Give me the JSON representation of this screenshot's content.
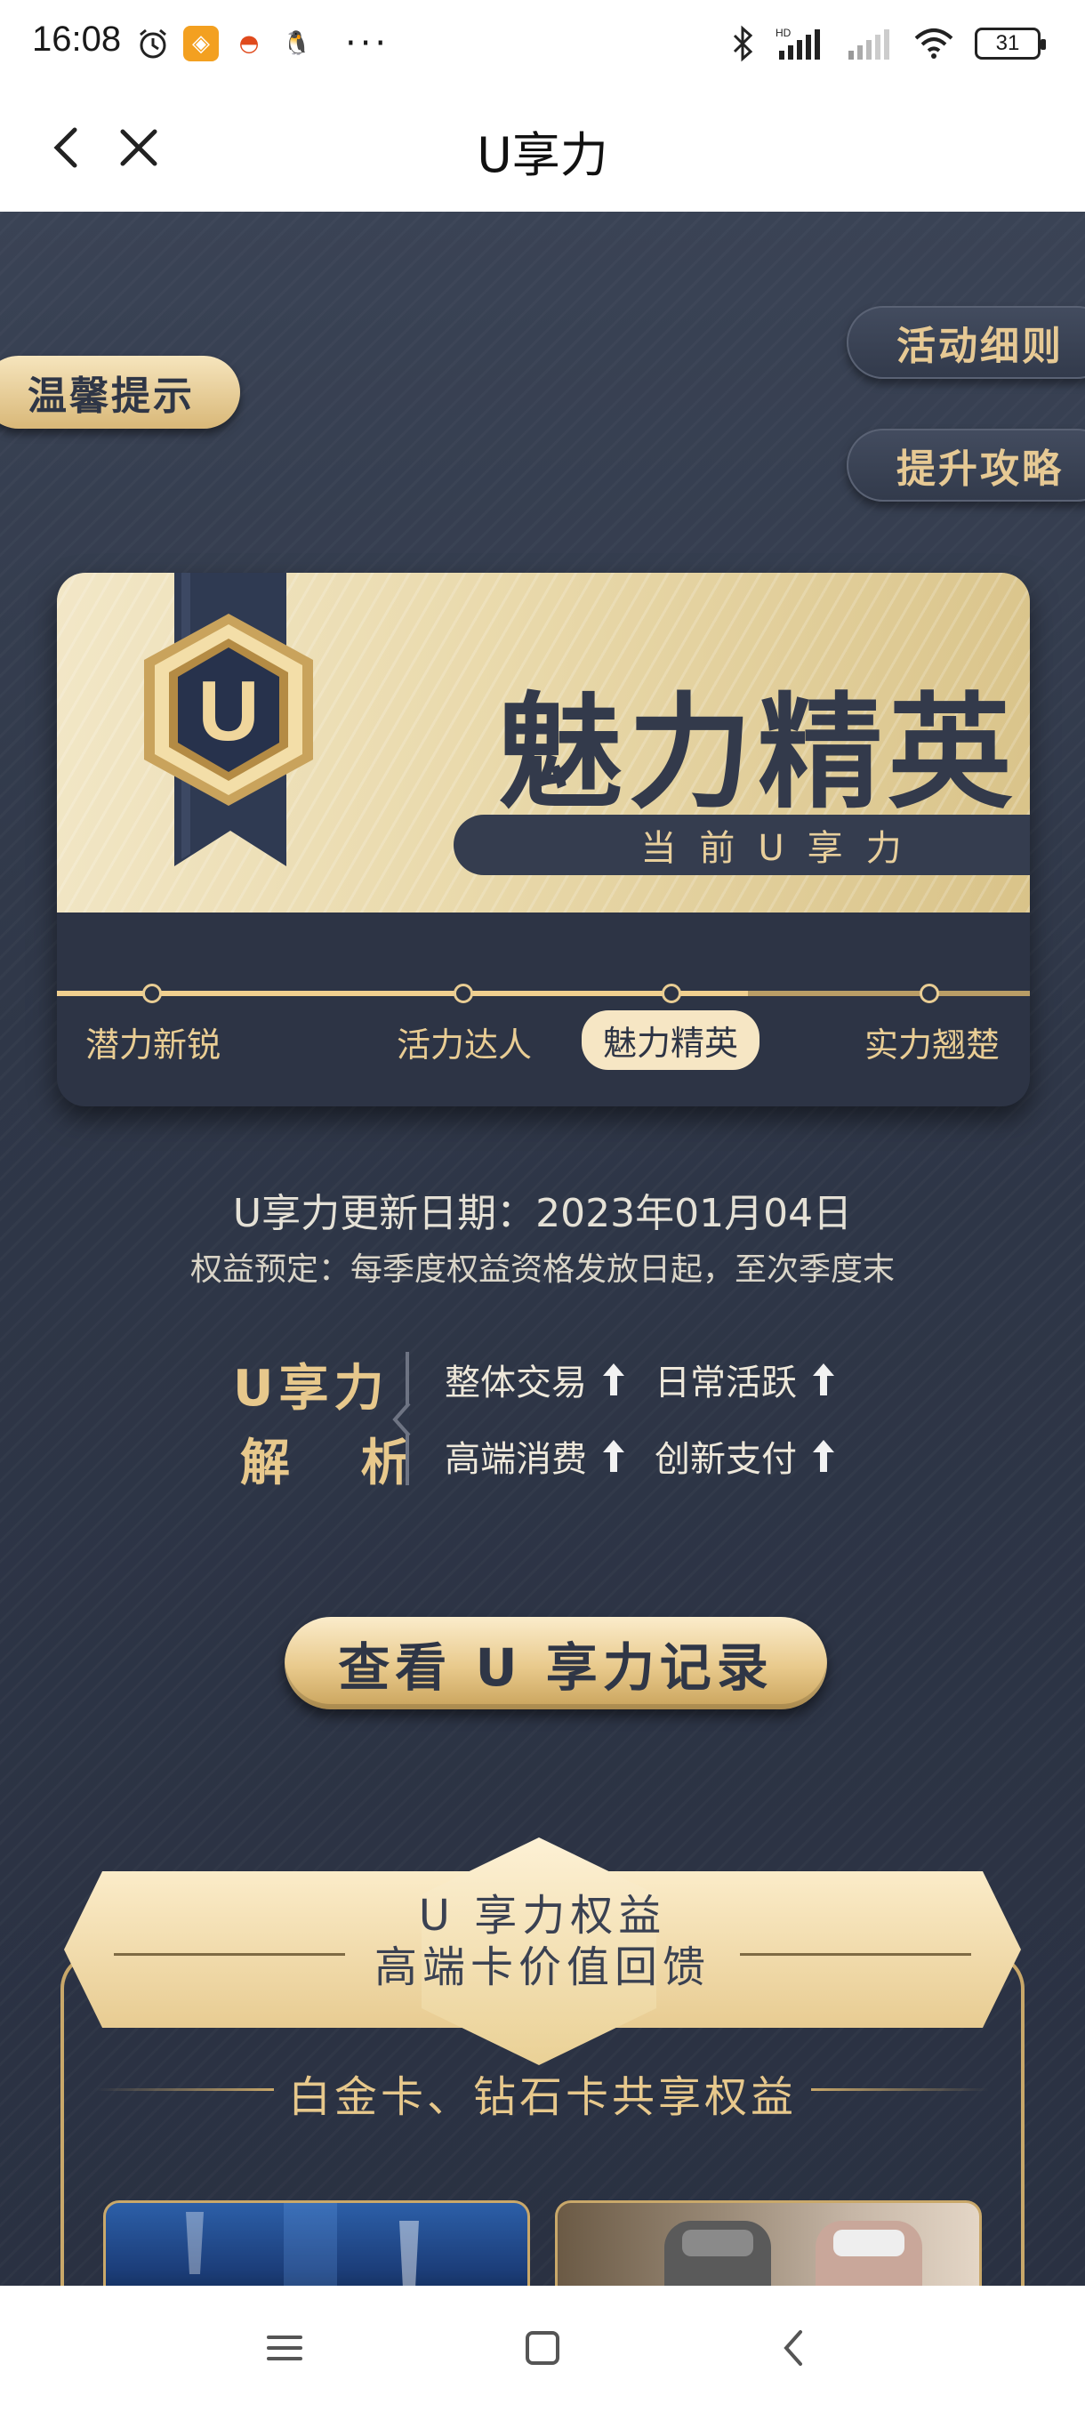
{
  "status_bar": {
    "time": "16:08",
    "battery": "31",
    "icons": [
      "alarm-icon",
      "app-orange-icon",
      "app-red-icon",
      "qq-icon",
      "more-dots-icon",
      "bluetooth-icon",
      "hd-signal-icon",
      "signal-icon",
      "wifi-icon",
      "battery-icon"
    ]
  },
  "nav": {
    "title": "U享力"
  },
  "buttons": {
    "tips": "温馨提示",
    "rules": "活动细则",
    "strategy": "提升攻略"
  },
  "level_card": {
    "badge_letter": "U",
    "level_name": "魅力精英",
    "current_label": "当前U享力",
    "progress_fraction": 0.71,
    "levels": [
      {
        "label": "潜力新锐"
      },
      {
        "label": "活力达人"
      },
      {
        "label": "魅力精英",
        "active": true
      },
      {
        "label": "实力翘楚"
      }
    ]
  },
  "update": {
    "date_text": "U享力更新日期：2023年01月04日",
    "rights_note": "权益预定：每季度权益资格发放日起，至次季度末"
  },
  "analysis": {
    "title_line1": "U享力",
    "title_line2": "解 析",
    "items": [
      "整体交易",
      "日常活跃",
      "高端消费",
      "创新支付"
    ]
  },
  "cta": {
    "label": "查看 U 享力记录"
  },
  "benefits": {
    "banner_line1": "U 享力权益",
    "banner_line2": "高端卡价值回馈",
    "shared_title": "白金卡、钻石卡共享权益"
  },
  "colors": {
    "gold": "#e7c88c",
    "navy": "#2f3748",
    "cream": "#f2e7c7"
  }
}
